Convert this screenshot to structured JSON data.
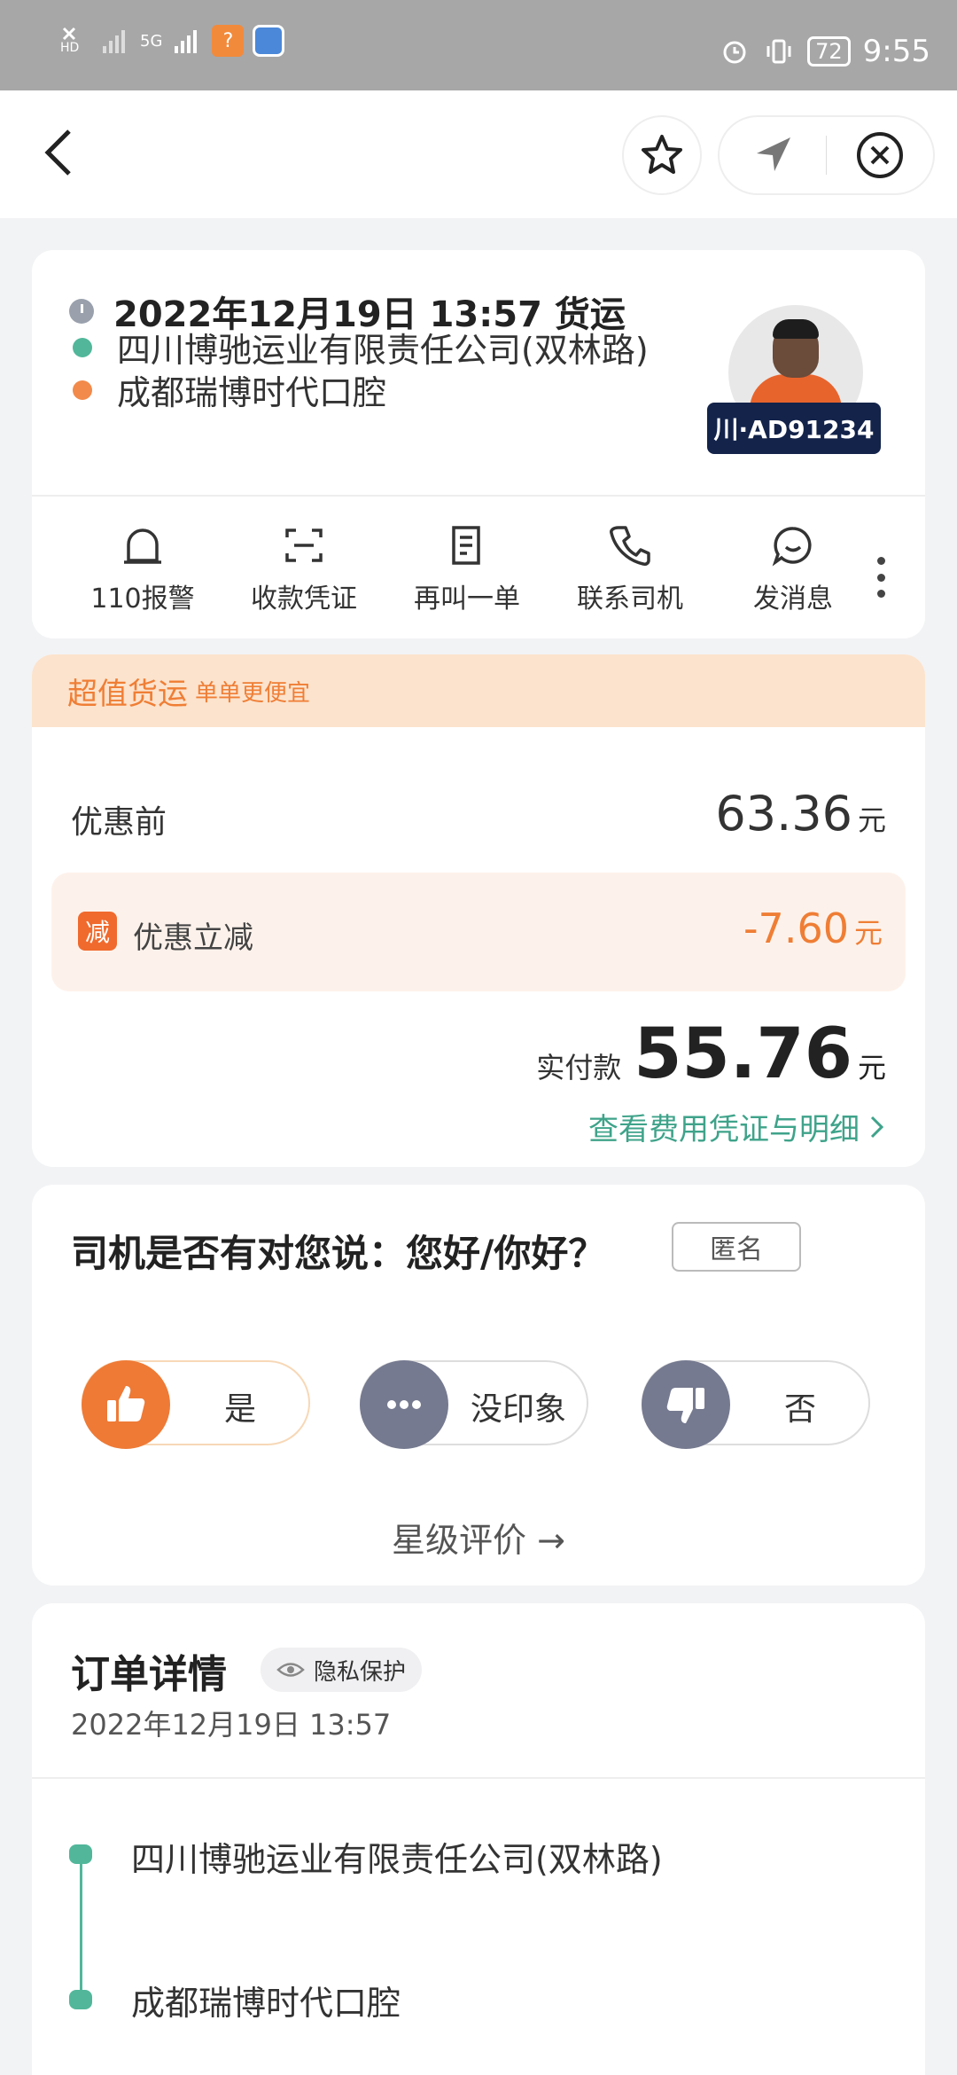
{
  "status_bar": {
    "network": "5G",
    "battery": "72",
    "time": "9:55"
  },
  "trip": {
    "datetime_type": "2022年12月19日 13:57 货运",
    "pickup": "四川博驰运业有限责任公司(双林路)",
    "dropoff": "成都瑞博时代口腔",
    "plate": "川·AD91234",
    "actions": [
      {
        "label": "110报警",
        "icon": "alarm-bell-icon"
      },
      {
        "label": "收款凭证",
        "icon": "receipt-scan-icon"
      },
      {
        "label": "再叫一单",
        "icon": "reorder-document-icon"
      },
      {
        "label": "联系司机",
        "icon": "phone-icon"
      },
      {
        "label": "发消息",
        "icon": "chat-bubble-icon"
      }
    ]
  },
  "fee": {
    "banner_title": "超值货运",
    "banner_sub": "单单更便宜",
    "original_label": "优惠前",
    "original_value": "63.36",
    "currency": "元",
    "discount_badge": "减",
    "discount_label": "优惠立减",
    "discount_value": "-7.60",
    "pay_label": "实付款",
    "pay_value": "55.76",
    "detail_link": "查看费用凭证与明细"
  },
  "feedback": {
    "question": "司机是否有对您说：您好/你好？",
    "anonymous": "匿名",
    "options": [
      "是",
      "没印象",
      "否"
    ],
    "rate_link": "星级评价 →"
  },
  "order": {
    "title": "订单详情",
    "privacy": "隐私保护",
    "date": "2022年12月19日 13:57",
    "pickup": "四川博驰运业有限责任公司(双林路)",
    "dropoff": "成都瑞博时代口腔"
  },
  "colors": {
    "accent_green": "#3fa38a",
    "accent_orange": "#ef7e35",
    "plate_bg": "#13234a"
  }
}
